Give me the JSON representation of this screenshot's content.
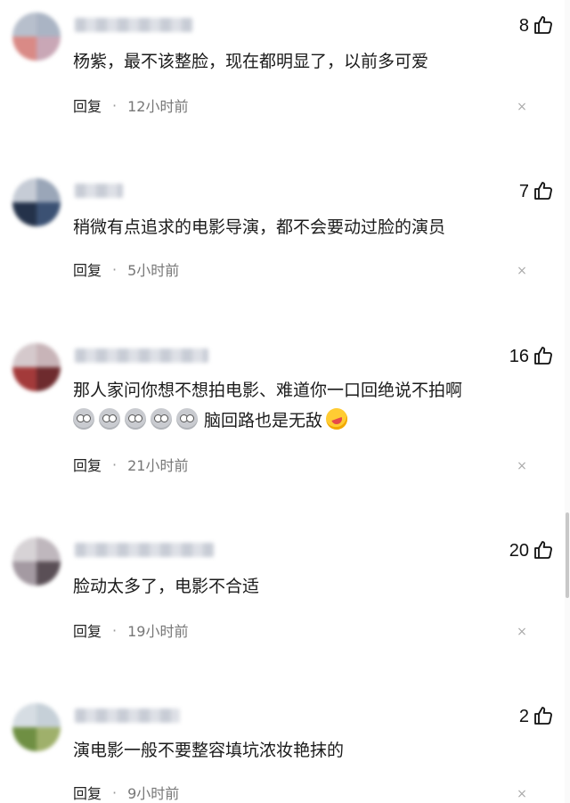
{
  "comments": [
    {
      "likes": "8",
      "content": "杨紫，最不该整脸，现在都明显了，以前多可爱",
      "reply_label": "回复",
      "time": "12小时前"
    },
    {
      "likes": "7",
      "content": "稍微有点追求的电影导演，都不会要动过脸的演员",
      "reply_label": "回复",
      "time": "5小时前"
    },
    {
      "likes": "16",
      "content": "那人家问你想不想拍电影、难道你一口回绝说不拍啊",
      "emoji_text": "脑回路也是无敌",
      "reply_label": "回复",
      "time": "21小时前"
    },
    {
      "likes": "20",
      "content": "脸动太多了，电影不合适",
      "reply_label": "回复",
      "time": "19小时前"
    },
    {
      "likes": "2",
      "content": "演电影一般不要整容填坑浓妆艳抹的",
      "reply_label": "回复",
      "time": "9小时前"
    }
  ],
  "separator": "·",
  "close_glyph": "×",
  "colors": {
    "text": "#1b1b1b",
    "time": "#777777",
    "close": "#aaaaaa"
  },
  "icons": [
    "thumbs-up-icon",
    "close-icon",
    "emoji-face-icon",
    "laugh-cry-icon"
  ]
}
